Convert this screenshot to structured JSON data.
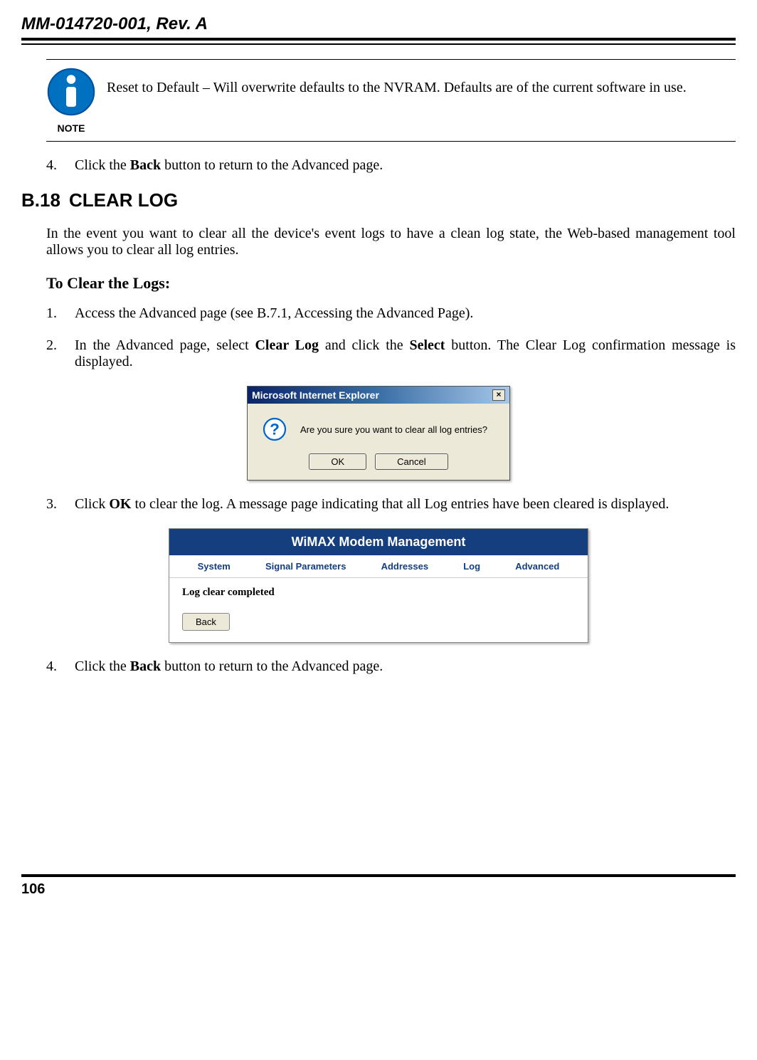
{
  "header": {
    "doc_id": "MM-014720-001, Rev. A"
  },
  "note": {
    "label": "NOTE",
    "text": "Reset to Default – Will overwrite defaults to the NVRAM.  Defaults are of the current software in use."
  },
  "step4a": {
    "num": "4.",
    "pre": "Click the ",
    "bold": "Back",
    "post": " button to return to the Advanced page."
  },
  "section": {
    "num": "B.18",
    "title": "CLEAR LOG"
  },
  "intro": "In the event you want to clear all the device's event logs to have a clean log state, the Web-based management tool allows you to clear all log entries.",
  "subheading": "To Clear the Logs:",
  "step1": {
    "num": "1.",
    "text": "Access the Advanced page (see B.7.1, Accessing the Advanced Page)."
  },
  "step2": {
    "num": "2.",
    "pre": "In the Advanced page, select ",
    "b1": "Clear Log",
    "mid": " and click the ",
    "b2": "Select",
    "post": " button.  The Clear Log confirmation message is displayed."
  },
  "dialog": {
    "title": "Microsoft Internet Explorer",
    "message": "Are you sure you want to clear all log entries?",
    "ok": "OK",
    "cancel": "Cancel"
  },
  "step3": {
    "num": "3.",
    "pre": "Click ",
    "b1": "OK",
    "post": " to clear the log.  A message page indicating that all Log entries have been cleared is displayed."
  },
  "wimax": {
    "title": "WiMAX Modem Management",
    "tabs": [
      "System",
      "Signal Parameters",
      "Addresses",
      "Log",
      "Advanced"
    ],
    "body": "Log clear completed",
    "back": "Back"
  },
  "step4b": {
    "num": "4.",
    "pre": "Click the ",
    "bold": "Back",
    "post": " button to return to the Advanced page."
  },
  "footer": {
    "page": "106"
  }
}
